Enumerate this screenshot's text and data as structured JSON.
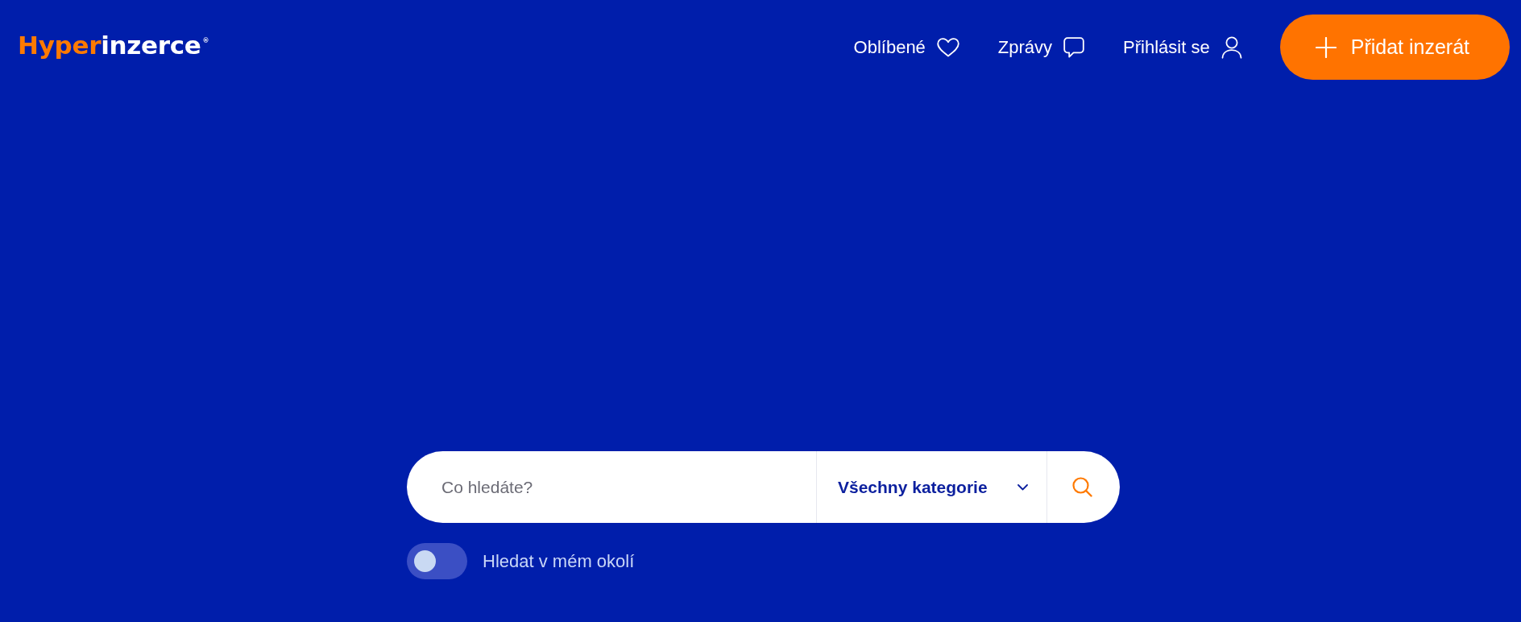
{
  "logo": {
    "accent": "Hyper",
    "rest": "inzerce",
    "mark": "®"
  },
  "nav": [
    {
      "kind": "favorites",
      "label": "Oblíbené"
    },
    {
      "kind": "messages",
      "label": "Zprávy"
    },
    {
      "kind": "login",
      "label": "Přihlásit se"
    }
  ],
  "add_button": {
    "label": "Přidat inzerát"
  },
  "search": {
    "placeholder": "Co hledáte?",
    "category": "Všechny kategorie"
  },
  "nearby": {
    "label": "Hledat v mém okolí",
    "on": false
  }
}
